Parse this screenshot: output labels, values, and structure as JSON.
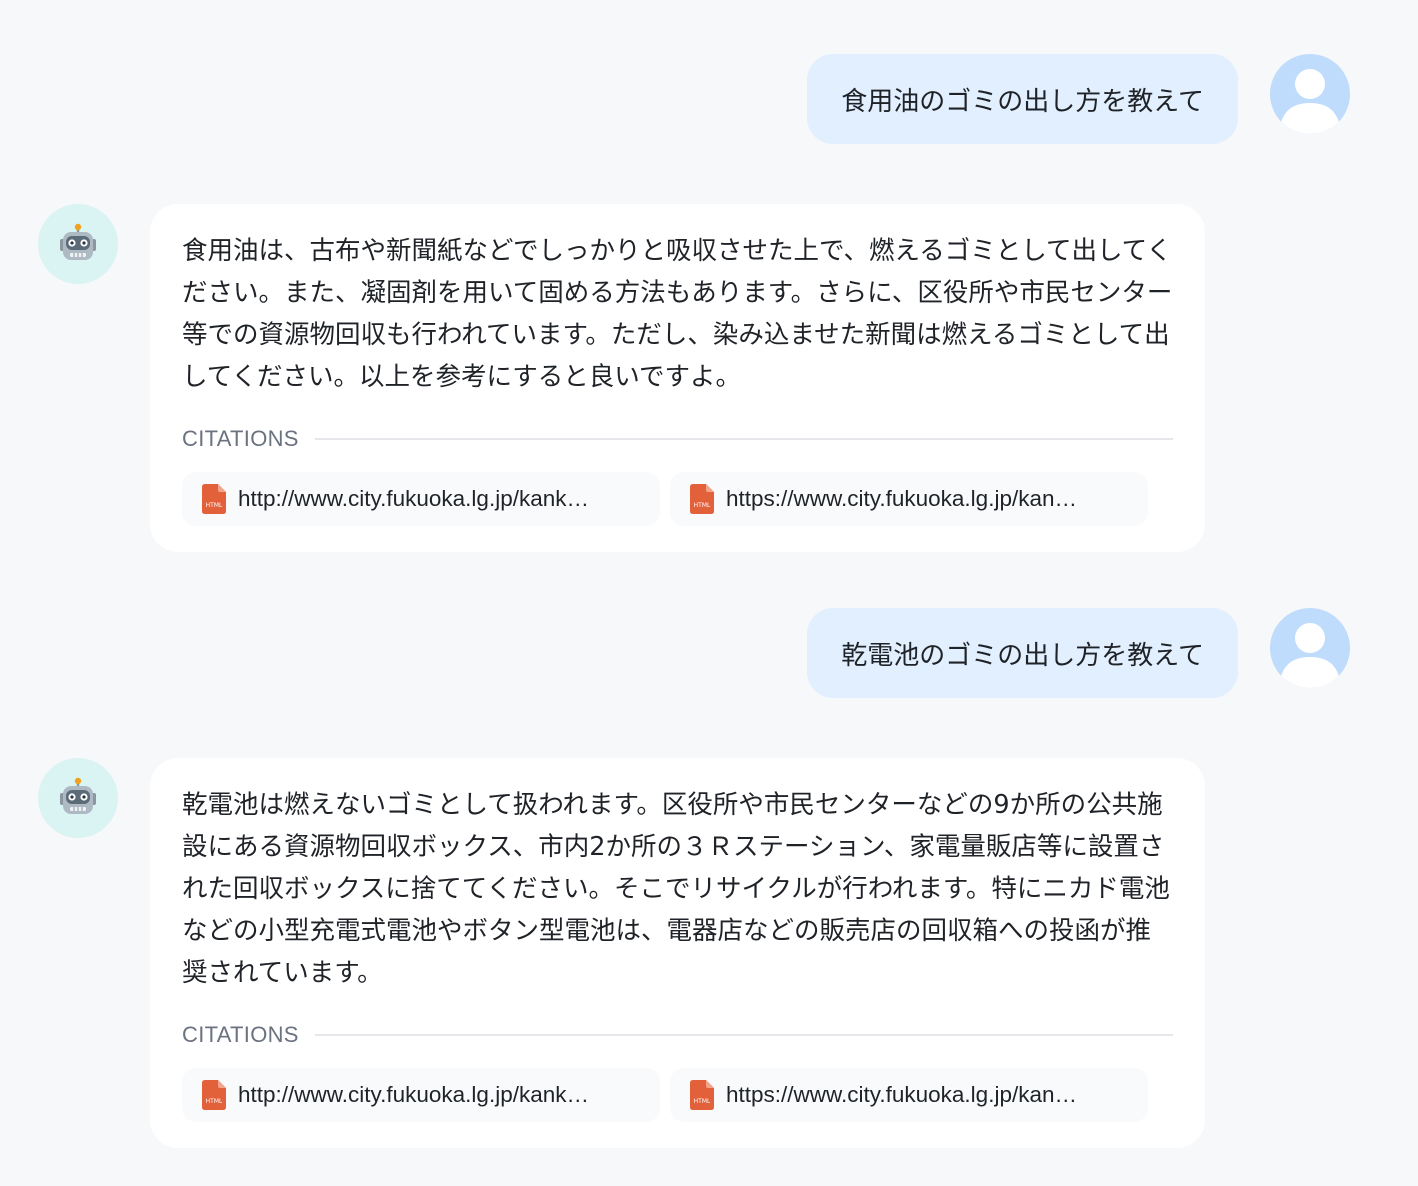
{
  "conversation": [
    {
      "user": {
        "text": "食用油のゴミの出し方を教えて"
      },
      "assistant": {
        "text": "食用油は、古布や新聞紙などでしっかりと吸収させた上で、燃えるゴミとして出してください。また、凝固剤を用いて固める方法もあります。さらに、区役所や市民センター等での資源物回収も行われています。ただし、染み込ませた新聞は燃えるゴミとして出してください。以上を参考にすると良いですよ。",
        "citations_label": "CITATIONS",
        "citations": [
          {
            "url": "http://www.city.fukuoka.lg.jp/kank…",
            "icon": "html-file-icon"
          },
          {
            "url": "https://www.city.fukuoka.lg.jp/kan…",
            "icon": "html-file-icon"
          }
        ]
      }
    },
    {
      "user": {
        "text": "乾電池のゴミの出し方を教えて"
      },
      "assistant": {
        "text": "乾電池は燃えないゴミとして扱われます。区役所や市民センターなどの9か所の公共施設にある資源物回収ボックス、市内2か所の３Ｒステーション、家電量販店等に設置された回収ボックスに捨ててください。そこでリサイクルが行われます。特にニカド電池などの小型充電式電池やボタン型電池は、電器店などの販売店の回収箱への投函が推奨されています。",
        "citations_label": "CITATIONS",
        "citations": [
          {
            "url": "http://www.city.fukuoka.lg.jp/kank…",
            "icon": "html-file-icon"
          },
          {
            "url": "https://www.city.fukuoka.lg.jp/kan…",
            "icon": "html-file-icon"
          }
        ]
      }
    }
  ],
  "colors": {
    "background": "#f7f8fa",
    "user_bubble": "#e1effe",
    "user_avatar": "#bfdcfd",
    "bot_avatar": "#daf3f3",
    "file_icon": "#e2603a"
  }
}
